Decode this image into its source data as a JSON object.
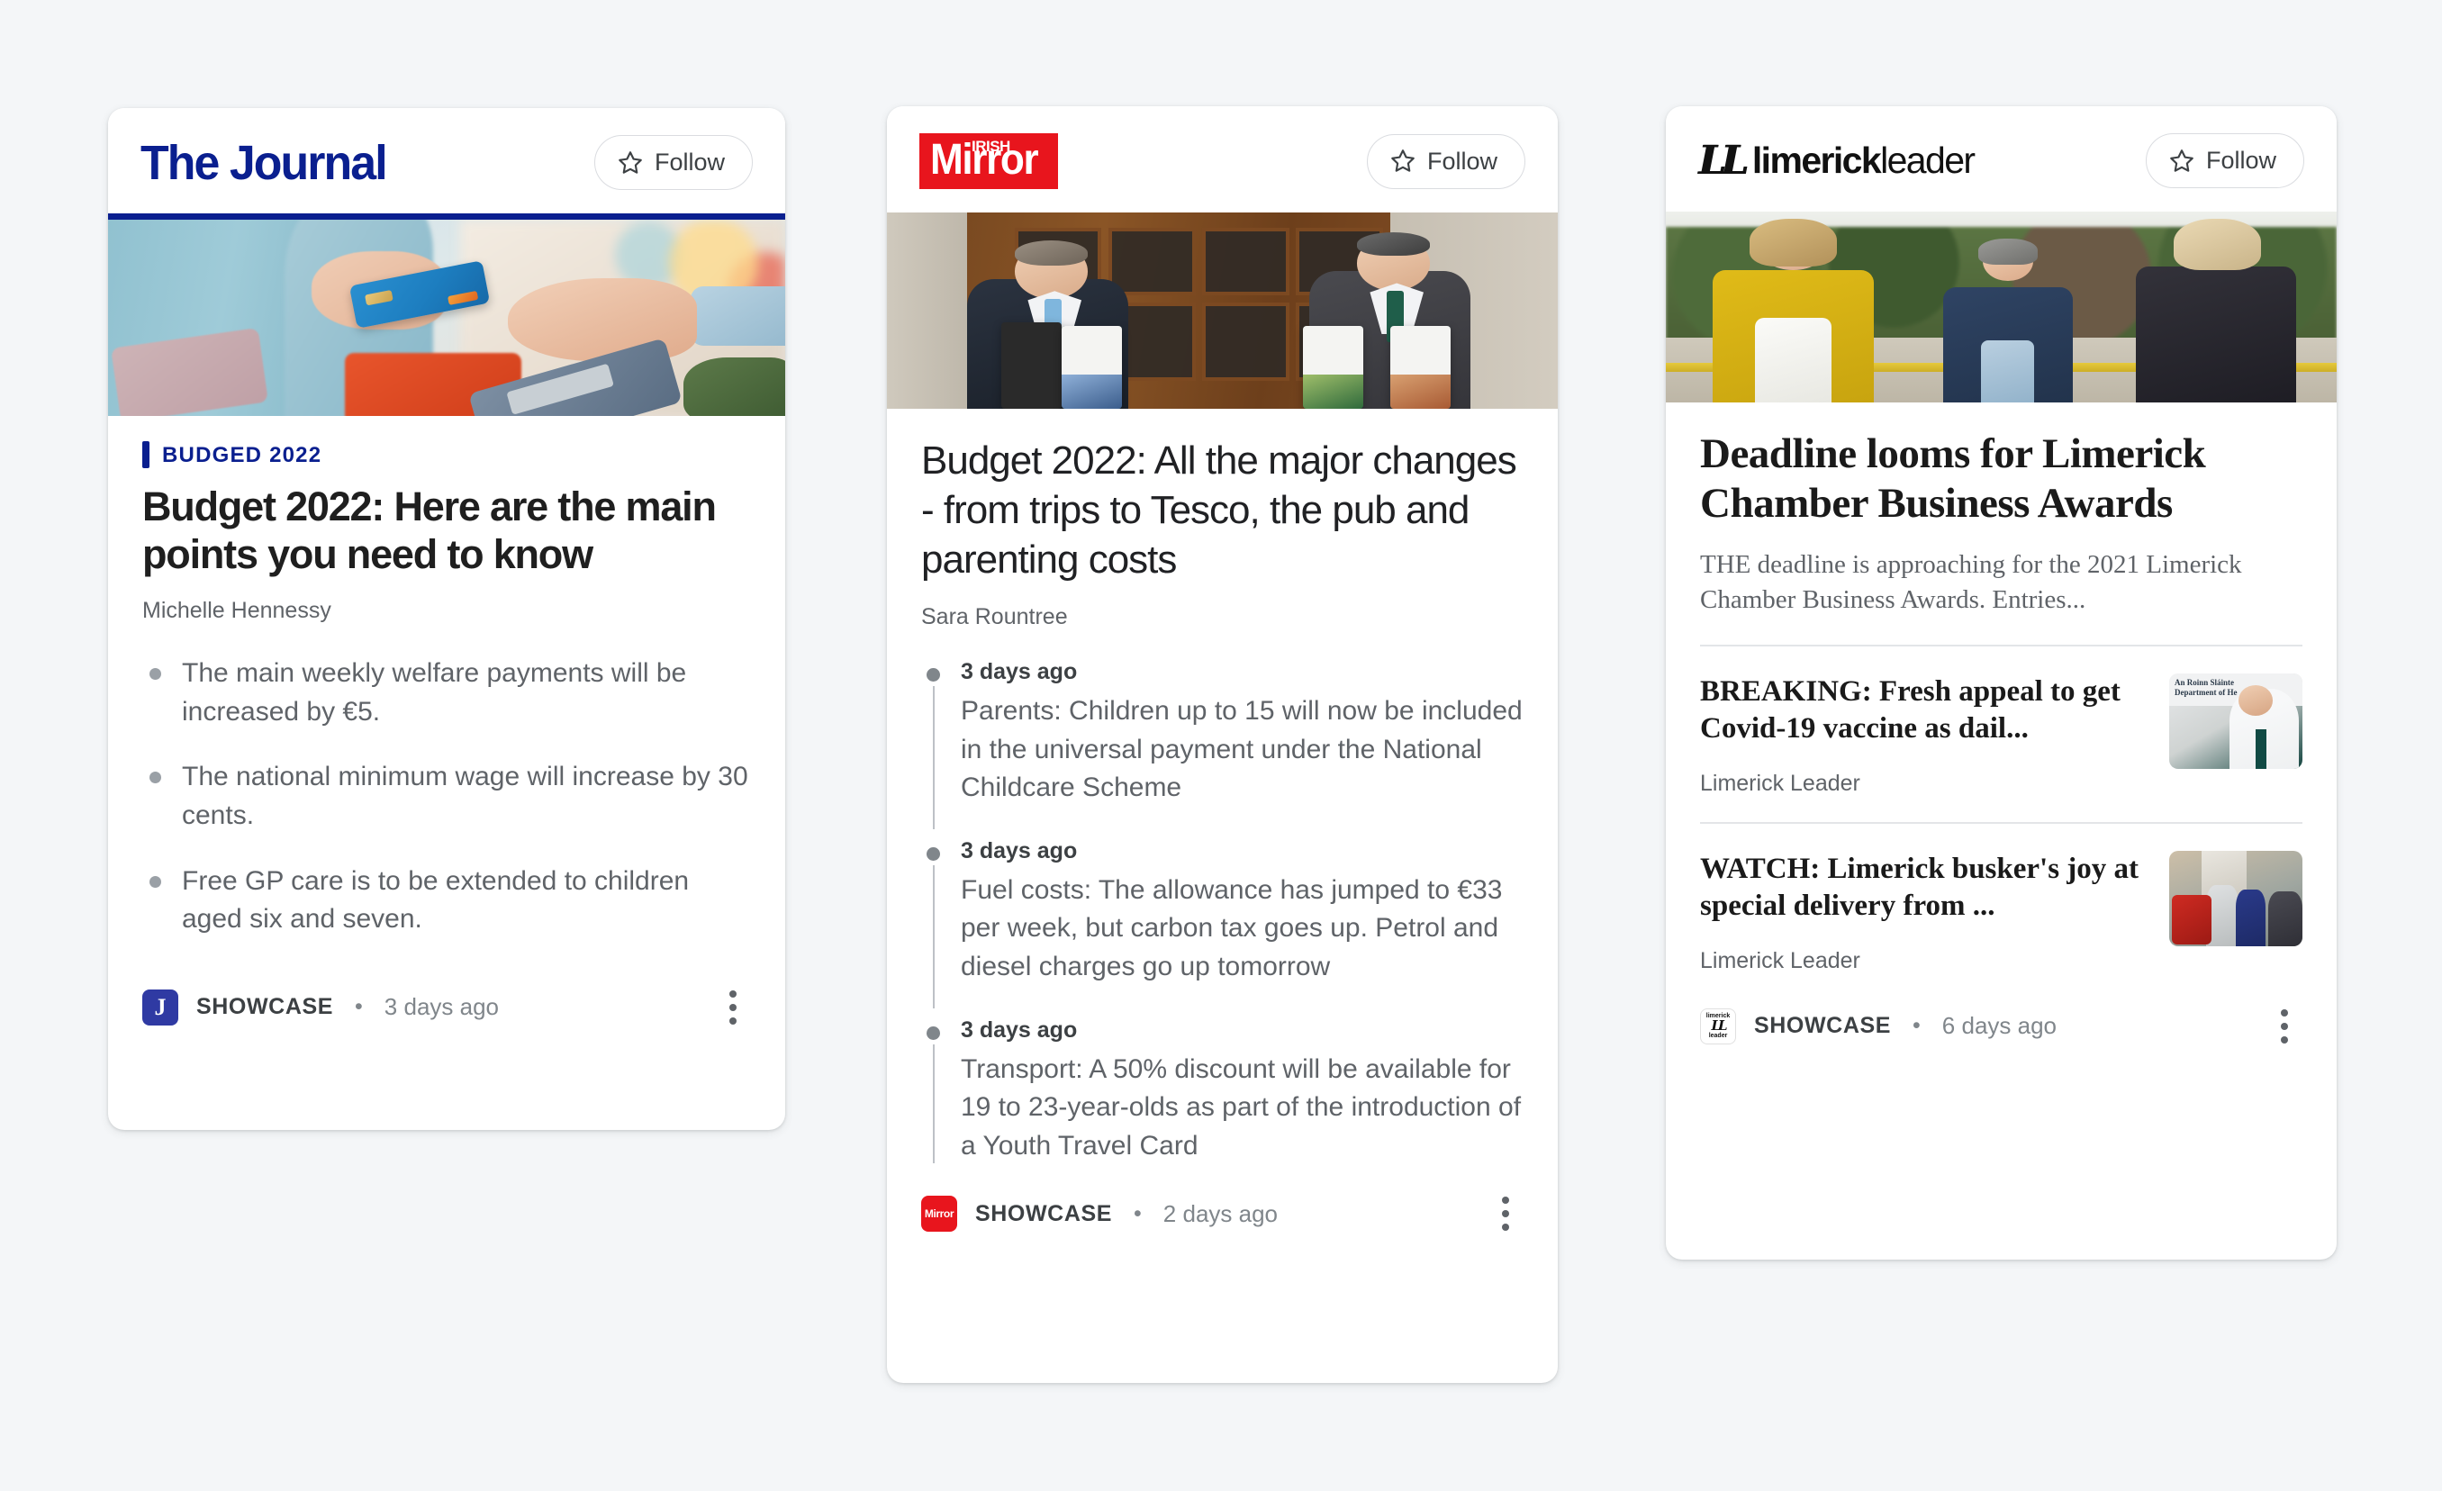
{
  "page": {
    "background_color": "#f4f6f8",
    "follow_label": "Follow",
    "showcase_label": "SHOWCASE",
    "separator": "•"
  },
  "cards": [
    {
      "publisher": "The Journal",
      "logo_type": "the-journal-wordmark",
      "brand_color": "#0a1f8f",
      "follow_label": "Follow",
      "hero_alt": "Shopper handing a blue credit card to a cashier at a supermarket checkout",
      "kicker": "BUDGED 2022",
      "headline": "Budget 2022: Here are the main points you need to know",
      "byline": "Michelle Hennessy",
      "bullets": [
        "The main weekly welfare payments will be increased by €5.",
        "The national minimum wage will increase by 30 cents.",
        "Free GP care is to be extended to children aged six and seven."
      ],
      "footer": {
        "favicon": "the-journal-favicon",
        "favicon_letter": "J",
        "showcase": "SHOWCASE",
        "time": "3 days ago"
      }
    },
    {
      "publisher": "Irish Mirror",
      "logo_type": "irish-mirror-wordmark",
      "logo_top": "IRISH",
      "logo_main": "Mirror",
      "brand_color": "#e8151d",
      "follow_label": "Follow",
      "hero_alt": "Two government ministers in suits holding Budget 2022 documents outside Government Buildings",
      "headline": "Budget 2022: All the major changes - from trips to Tesco, the pub and parenting costs",
      "byline": "Sara Rountree",
      "timeline": [
        {
          "time": "3 days ago",
          "text": "Parents: Children up to 15 will now be included in the universal payment under the National Childcare Scheme"
        },
        {
          "time": "3 days ago",
          "text": "Fuel costs: The allowance has jumped to €33 per week, but carbon tax goes up. Petrol and diesel charges go up tomorrow"
        },
        {
          "time": "3 days ago",
          "text": "Transport: A 50% discount will be available for 19 to 23-year-olds as part of the introduction of a Youth Travel Card"
        }
      ],
      "footer": {
        "favicon": "irish-mirror-favicon",
        "favicon_letter": "Mirror",
        "showcase": "SHOWCASE",
        "time": "2 days ago"
      }
    },
    {
      "publisher": "limerickleader",
      "logo_type": "limerick-leader-wordmark",
      "logo_mono": "LL",
      "logo_bold": "limerick",
      "logo_light": "leader",
      "follow_label": "Follow",
      "hero_alt": "Three people standing outdoors in front of hedges, a woman in a yellow blazer, a man in a navy suit and a woman in black",
      "headline": "Deadline looms for Limerick Chamber Business Awards",
      "summary": "THE deadline is approaching for the 2021 Limerick Chamber Business Awards. Entries...",
      "articles": [
        {
          "title": "BREAKING: Fresh appeal to get Covid-19 vaccine as dail...",
          "source": "Limerick Leader",
          "thumb_alt": "Man in white shirt and dark green tie in front of Department of Health sign"
        },
        {
          "title": "WATCH: Limerick busker's joy at special delivery from ...",
          "source": "Limerick Leader",
          "thumb_alt": "Group of people outside a house with a red accordion"
        }
      ],
      "footer": {
        "favicon": "limerick-leader-favicon",
        "favicon_top": "limerick",
        "favicon_mono": "LL",
        "favicon_bottom": "leader",
        "showcase": "SHOWCASE",
        "time": "6 days ago"
      }
    }
  ]
}
